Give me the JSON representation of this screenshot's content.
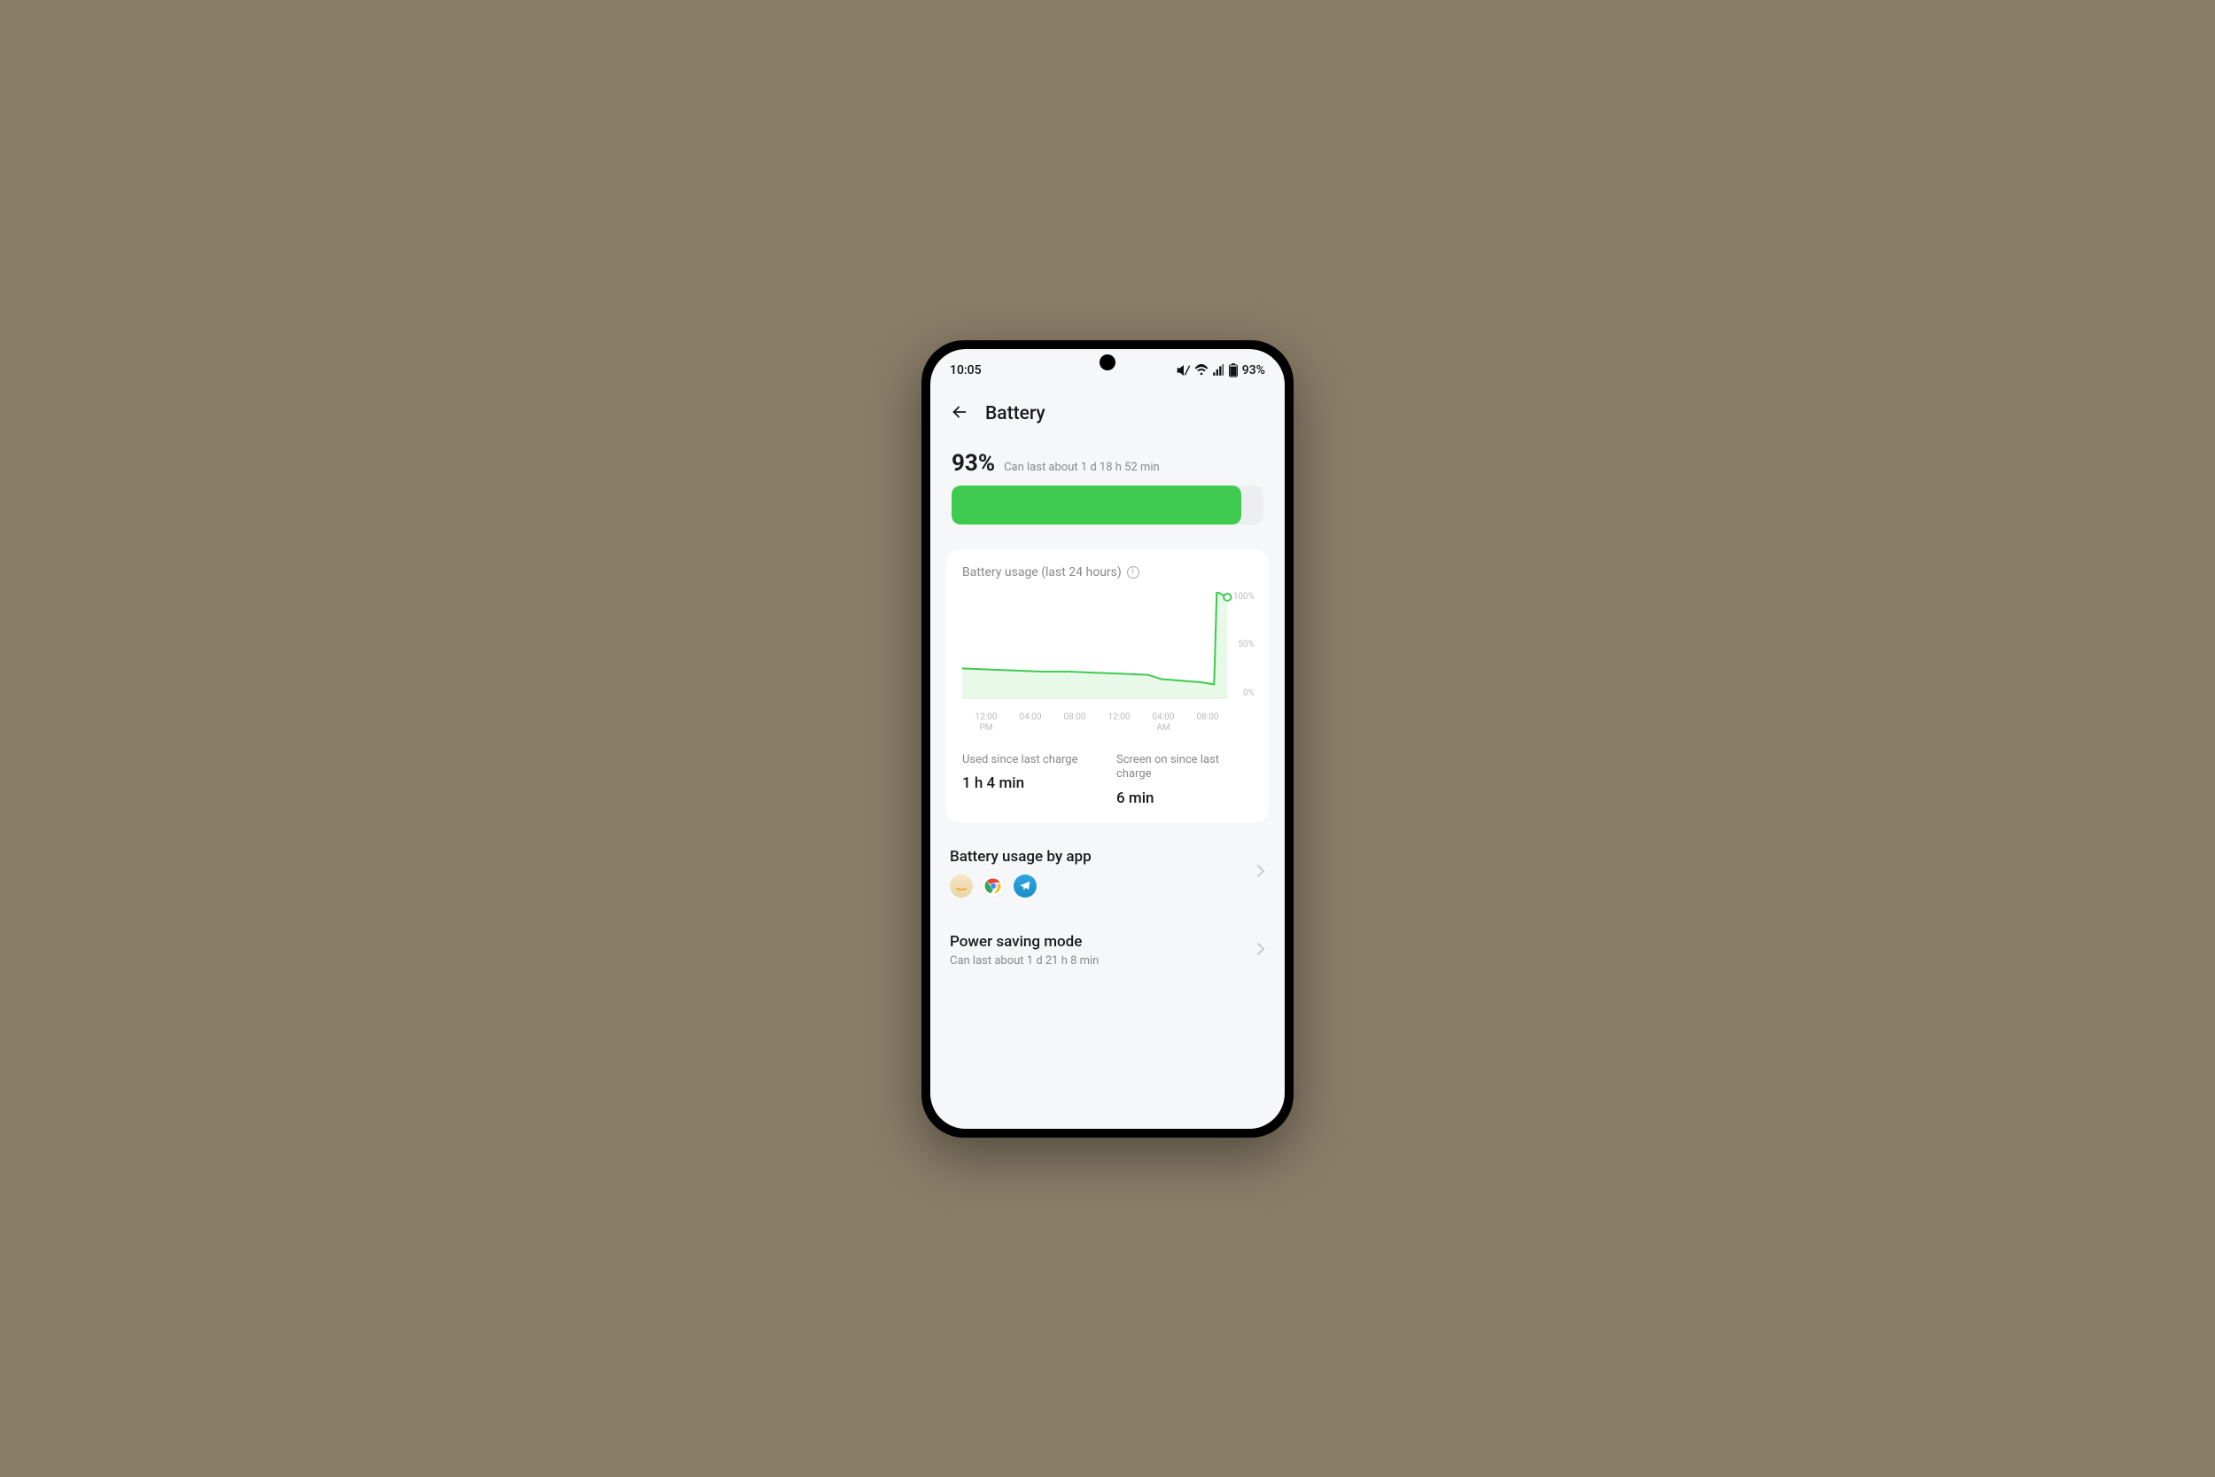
{
  "status_bar": {
    "time": "10:05",
    "battery_text": "93%"
  },
  "header": {
    "title": "Battery"
  },
  "summary": {
    "percentage": "93%",
    "estimate": "Can last about 1 d 18 h 52 min",
    "fill_percent": 93
  },
  "usage_card": {
    "title": "Battery usage (last 24 hours)",
    "used_label": "Used since last charge",
    "used_value": "1 h 4 min",
    "screen_label": "Screen on since last charge",
    "screen_value": "6 min"
  },
  "chart_data": {
    "type": "area",
    "title": "Battery usage (last 24 hours)",
    "xlabel": "",
    "ylabel": "",
    "ylim": [
      0,
      100
    ],
    "x_ticks": [
      "12:00\nPM",
      "04:00",
      "08:00",
      "12:00",
      "04:00\nAM",
      "08:00"
    ],
    "y_ticks": [
      "100%",
      "50%",
      "0%"
    ],
    "series": [
      {
        "name": "battery",
        "x": [
          0,
          2,
          4,
          6,
          8,
          10,
          12,
          14,
          15,
          16,
          18,
          19,
          19.2,
          20
        ],
        "values": [
          28,
          27,
          26,
          25,
          25,
          24,
          23,
          22,
          18,
          17,
          15,
          13,
          100,
          95
        ]
      }
    ]
  },
  "apps": {
    "title": "Battery usage by app",
    "icons": [
      "amazon",
      "chrome",
      "telegram"
    ]
  },
  "power_saving": {
    "title": "Power saving mode",
    "subtitle": "Can last about 1 d 21 h 8 min"
  },
  "colors": {
    "accent": "#3fcb4f"
  }
}
